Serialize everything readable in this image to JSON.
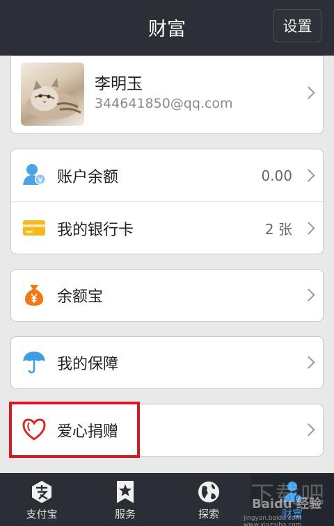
{
  "header": {
    "title": "财富",
    "settings_label": "设置"
  },
  "profile": {
    "name": "李明玉",
    "email": "344641850@qq.com"
  },
  "accounts": [
    {
      "label": "账户余额",
      "value": "0.00",
      "icon": "user-balance-icon"
    },
    {
      "label": "我的银行卡",
      "value": "2 张",
      "icon": "bank-card-icon"
    }
  ],
  "yuebao": {
    "label": "余额宝",
    "icon": "money-bag-icon"
  },
  "insurance": {
    "label": "我的保障",
    "icon": "umbrella-icon"
  },
  "charity": {
    "label": "爱心捐赠",
    "icon": "heart-icon"
  },
  "tabs": [
    {
      "label": "支付宝",
      "icon": "alipay-icon"
    },
    {
      "label": "服务",
      "icon": "star-bookmark-icon"
    },
    {
      "label": "探索",
      "icon": "globe-icon"
    },
    {
      "label": "财富",
      "icon": "wealth-icon",
      "active": true
    }
  ],
  "watermark": {
    "big": "下载吧",
    "brand": "Baidu 经验",
    "url": "jingyan.baidu.com  www.xiazaiba.com"
  },
  "colors": {
    "accent": "#3aa0f0",
    "highlight": "#d8191f",
    "bar": "#2c2f36"
  }
}
